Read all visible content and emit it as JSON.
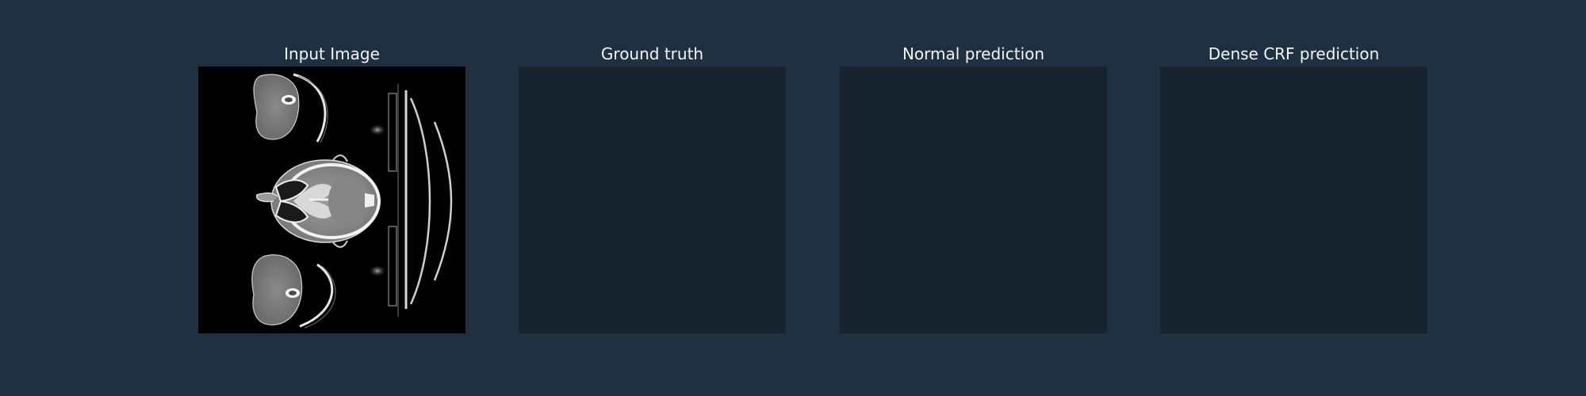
{
  "colors": {
    "background": "#1f3140",
    "empty_panel": "#172430",
    "title_text": "#f2f4f6"
  },
  "panels": [
    {
      "title": "Input Image"
    },
    {
      "title": "Ground truth"
    },
    {
      "title": "Normal prediction"
    },
    {
      "title": "Dense CRF prediction"
    }
  ]
}
